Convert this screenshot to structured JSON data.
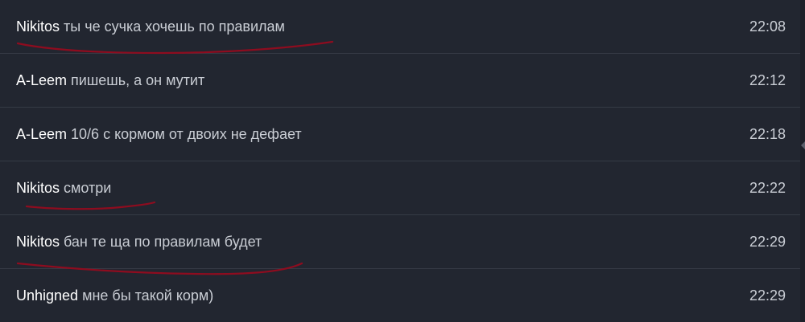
{
  "messages": [
    {
      "author": "Nikitos",
      "text": "ты че сучка хочешь по правилам",
      "time": "22:08"
    },
    {
      "author": "A-Leem",
      "text": "пишешь, а он мутит",
      "time": "22:12"
    },
    {
      "author": "A-Leem",
      "text": "10/6 с кормом от двоих не дефает",
      "time": "22:18"
    },
    {
      "author": "Nikitos",
      "text": "смотри",
      "time": "22:22"
    },
    {
      "author": "Nikitos",
      "text": "бан те ща по правилам будет",
      "time": "22:29"
    },
    {
      "author": "Unhigned",
      "text": "мне бы такой корм)",
      "time": "22:29"
    }
  ],
  "annotation_color": "#8e0c1f"
}
